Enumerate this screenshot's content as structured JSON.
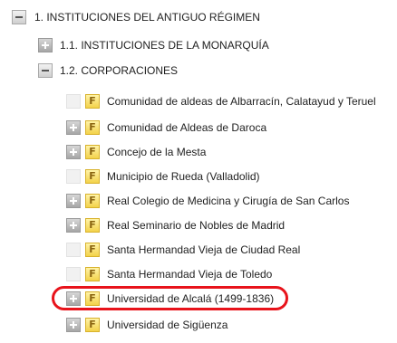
{
  "tree": {
    "root": {
      "label": "1. INSTITUCIONES DEL ANTIGUO RÉGIMEN",
      "toggle_icon": "collapse-minus-icon"
    },
    "level1": [
      {
        "label": "1.1. INSTITUCIONES DE LA MONARQUÍA",
        "toggle_icon": "expand-plus-icon",
        "expanded": false
      },
      {
        "label": "1.2. CORPORACIONES",
        "toggle_icon": "collapse-minus-icon",
        "expanded": true
      }
    ],
    "corporaciones_items": [
      {
        "badge": "F",
        "label": "Comunidad de aldeas de Albarracín, Calatayud y Teruel",
        "has_children": false
      },
      {
        "badge": "F",
        "label": "Comunidad de Aldeas de Daroca",
        "has_children": true
      },
      {
        "badge": "F",
        "label": "Concejo de la Mesta",
        "has_children": true
      },
      {
        "badge": "F",
        "label": "Municipio de Rueda (Valladolid)",
        "has_children": false
      },
      {
        "badge": "F",
        "label": "Real Colegio de Medicina y Cirugía de San Carlos",
        "has_children": true
      },
      {
        "badge": "F",
        "label": "Real Seminario de Nobles de Madrid",
        "has_children": true
      },
      {
        "badge": "F",
        "label": "Santa Hermandad Vieja de Ciudad Real",
        "has_children": false
      },
      {
        "badge": "F",
        "label": "Santa Hermandad Vieja de Toledo",
        "has_children": false
      },
      {
        "badge": "F",
        "label": "Universidad de Alcalá (1499-1836)",
        "has_children": true,
        "highlighted": true
      },
      {
        "badge": "F",
        "label": "Universidad de Sigüenza",
        "has_children": true
      }
    ]
  },
  "colors": {
    "highlight_outline": "#e8131b",
    "fonds_badge": "#f3d24a",
    "text": "#222222"
  }
}
